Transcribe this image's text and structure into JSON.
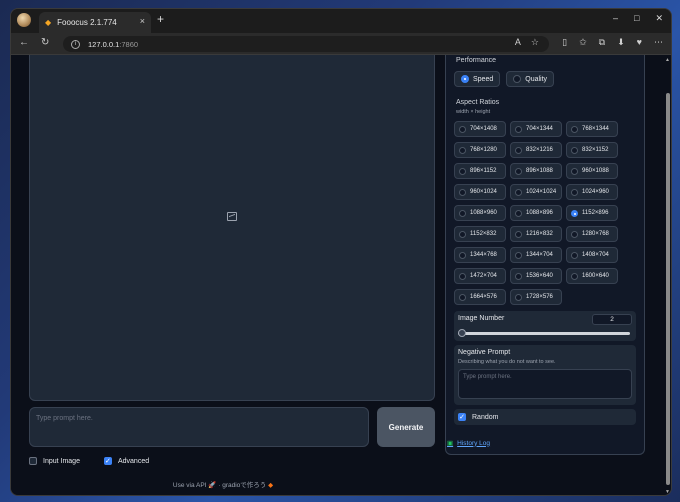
{
  "browser": {
    "tab_title": "Fooocus 2.1.774",
    "tab_close": "×",
    "new_tab": "+",
    "url_host": "127.0.0.1",
    "url_port": ":7860",
    "controls": {
      "minimize": "–",
      "maximize": "□",
      "close": "✕"
    }
  },
  "main": {
    "prompt_placeholder": "Type prompt here.",
    "generate_label": "Generate",
    "input_image_label": "Input Image",
    "input_image_checked": false,
    "advanced_label": "Advanced",
    "advanced_checked": true,
    "footer_api": "Use via API",
    "footer_sep": "·",
    "footer_gradio": "gradioで作ろう"
  },
  "settings": {
    "performance_label": "Performance",
    "performance_options": [
      "Speed",
      "Quality"
    ],
    "performance_selected": "Speed",
    "aspect_label": "Aspect Ratios",
    "aspect_sub": "width × height",
    "aspect_ratios": [
      "704×1408",
      "704×1344",
      "768×1344",
      "768×1280",
      "832×1216",
      "832×1152",
      "896×1152",
      "896×1088",
      "960×1088",
      "960×1024",
      "1024×1024",
      "1024×960",
      "1088×960",
      "1088×896",
      "1152×896",
      "1152×832",
      "1216×832",
      "1280×768",
      "1344×768",
      "1344×704",
      "1408×704",
      "1472×704",
      "1536×640",
      "1600×640",
      "1664×576",
      "1728×576"
    ],
    "aspect_selected": "1152×896",
    "image_number_label": "Image Number",
    "image_number_value": "2",
    "image_number_min": 1,
    "image_number_max": 32,
    "negative_label": "Negative Prompt",
    "negative_sub": "Describing what you do not want to see.",
    "negative_placeholder": "Type prompt here.",
    "random_label": "Random",
    "random_checked": true,
    "history_label": "History Log"
  }
}
